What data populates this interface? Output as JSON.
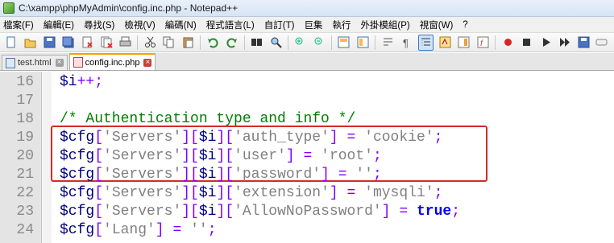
{
  "window": {
    "title": "C:\\xampp\\phpMyAdmin\\config.inc.php - Notepad++"
  },
  "menu": [
    "檔案(F)",
    "編輯(E)",
    "尋找(S)",
    "檢視(V)",
    "編碼(N)",
    "程式語言(L)",
    "自訂(T)",
    "巨集",
    "執行",
    "外掛模組(P)",
    "視窗(W)",
    "?"
  ],
  "toolbar": {
    "icons": [
      "new-file-icon",
      "open-file-icon",
      "save-icon",
      "save-all-icon",
      "close-icon",
      "close-all-icon",
      "print-icon",
      "cut-icon",
      "copy-icon",
      "paste-icon",
      "undo-icon",
      "redo-icon",
      "find-icon",
      "replace-icon",
      "zoom-in-icon",
      "zoom-out-icon",
      "sync-v-icon",
      "sync-h-icon",
      "wrap-icon",
      "all-chars-icon",
      "indent-guide-icon",
      "udl-icon",
      "doc-map-icon",
      "function-list-icon",
      "record-macro-icon",
      "stop-macro-icon",
      "play-macro-icon",
      "run-macro-multiple-icon",
      "save-macro-icon"
    ],
    "active_icon": "indent-guide-icon"
  },
  "tabs": [
    {
      "label": "test.html",
      "active": false
    },
    {
      "label": "config.inc.php",
      "active": true
    }
  ],
  "editor": {
    "lines": [
      {
        "num": "16",
        "tokens": [
          [
            "var",
            "$i"
          ],
          [
            "op",
            "++"
          ],
          [
            "op",
            ";"
          ]
        ]
      },
      {
        "num": "17",
        "tokens": []
      },
      {
        "num": "18",
        "tokens": [
          [
            "comment",
            "/* Authentication type and info */"
          ]
        ]
      },
      {
        "num": "19",
        "tokens": [
          [
            "var",
            "$cfg"
          ],
          [
            "op",
            "["
          ],
          [
            "str",
            "'Servers'"
          ],
          [
            "op",
            "]["
          ],
          [
            "var",
            "$i"
          ],
          [
            "op",
            "]["
          ],
          [
            "str",
            "'auth_type'"
          ],
          [
            "op",
            "]"
          ],
          [
            "plain",
            " "
          ],
          [
            "op",
            "="
          ],
          [
            "plain",
            " "
          ],
          [
            "str",
            "'cookie'"
          ],
          [
            "op",
            ";"
          ]
        ]
      },
      {
        "num": "20",
        "tokens": [
          [
            "var",
            "$cfg"
          ],
          [
            "op",
            "["
          ],
          [
            "str",
            "'Servers'"
          ],
          [
            "op",
            "]["
          ],
          [
            "var",
            "$i"
          ],
          [
            "op",
            "]["
          ],
          [
            "str",
            "'user'"
          ],
          [
            "op",
            "]"
          ],
          [
            "plain",
            " "
          ],
          [
            "op",
            "="
          ],
          [
            "plain",
            " "
          ],
          [
            "str",
            "'root'"
          ],
          [
            "op",
            ";"
          ]
        ]
      },
      {
        "num": "21",
        "tokens": [
          [
            "var",
            "$cfg"
          ],
          [
            "op",
            "["
          ],
          [
            "str",
            "'Servers'"
          ],
          [
            "op",
            "]["
          ],
          [
            "var",
            "$i"
          ],
          [
            "op",
            "]["
          ],
          [
            "str",
            "'password'"
          ],
          [
            "op",
            "]"
          ],
          [
            "plain",
            " "
          ],
          [
            "op",
            "="
          ],
          [
            "plain",
            " "
          ],
          [
            "str",
            "''"
          ],
          [
            "op",
            ";"
          ]
        ]
      },
      {
        "num": "22",
        "tokens": [
          [
            "var",
            "$cfg"
          ],
          [
            "op",
            "["
          ],
          [
            "str",
            "'Servers'"
          ],
          [
            "op",
            "]["
          ],
          [
            "var",
            "$i"
          ],
          [
            "op",
            "]["
          ],
          [
            "str",
            "'extension'"
          ],
          [
            "op",
            "]"
          ],
          [
            "plain",
            " "
          ],
          [
            "op",
            "="
          ],
          [
            "plain",
            " "
          ],
          [
            "str",
            "'mysqli'"
          ],
          [
            "op",
            ";"
          ]
        ]
      },
      {
        "num": "23",
        "tokens": [
          [
            "var",
            "$cfg"
          ],
          [
            "op",
            "["
          ],
          [
            "str",
            "'Servers'"
          ],
          [
            "op",
            "]["
          ],
          [
            "var",
            "$i"
          ],
          [
            "op",
            "]["
          ],
          [
            "str",
            "'AllowNoPassword'"
          ],
          [
            "op",
            "]"
          ],
          [
            "plain",
            " "
          ],
          [
            "op",
            "="
          ],
          [
            "plain",
            " "
          ],
          [
            "kw",
            "true"
          ],
          [
            "op",
            ";"
          ]
        ]
      },
      {
        "num": "24",
        "tokens": [
          [
            "var",
            "$cfg"
          ],
          [
            "op",
            "["
          ],
          [
            "str",
            "'Lang'"
          ],
          [
            "op",
            "]"
          ],
          [
            "plain",
            " "
          ],
          [
            "op",
            "="
          ],
          [
            "plain",
            " "
          ],
          [
            "str",
            "''"
          ],
          [
            "op",
            ";"
          ]
        ]
      }
    ],
    "highlighted_lines": [
      "19",
      "20",
      "21"
    ],
    "colors": {
      "highlight_border": "#d42a2a",
      "comment": "#008000",
      "string": "#808080",
      "operator": "#8000ff",
      "variable": "#000080",
      "keyword": "#0000ff"
    }
  }
}
